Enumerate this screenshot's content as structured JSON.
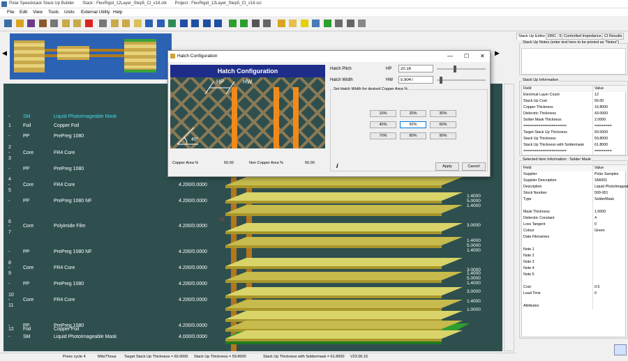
{
  "window": {
    "app_name": "Polar Speedstack Stack Up Builder",
    "stack": "Stack : FlexRigid_12Layer_Step5_CI_v18.stk",
    "project": "Project : FlexRigid_12Layer_Step5_CI_v18.sci"
  },
  "menu": [
    "File",
    "Edit",
    "View",
    "Tools",
    "Units",
    "External Utility",
    "Help"
  ],
  "toolbar_icons": [
    "new-stack-icon",
    "open-icon",
    "wizard-icon",
    "library-icon",
    "notes-icon",
    "stackup-icon",
    "rigid-flex-icon",
    "delete-icon",
    "copy-icon",
    "layer-add-icon",
    "core-add-icon",
    "prepreg-add-icon",
    "plane-add-icon",
    "signal-add-icon",
    "impedance-icon",
    "drill-icon",
    "drill-blind-icon",
    "drill-buried-icon",
    "drill-through-icon",
    "move-up-icon",
    "move-down-icon",
    "report-icon",
    "fab-icon",
    "color-icon",
    "coverlay-icon",
    "yellow-block-icon",
    "panel-icon",
    "layers-view-icon",
    "export-icon",
    "print-icon",
    "grid-icon"
  ],
  "banner": {
    "left_arrow": "◀",
    "right_arrow": "▶"
  },
  "layers": [
    {
      "num": "-",
      "type": "SM",
      "desc": "Liquid PhotoImageable Mask",
      "thick": "",
      "highlight": true
    },
    {
      "num": "1",
      "type": "Foil",
      "desc": "Copper Foil",
      "thick": ""
    },
    {
      "num": "-",
      "type": "PP",
      "desc": "PrePreg 1080",
      "thick": ""
    },
    {
      "num": "2",
      "type": "",
      "desc": "",
      "thick": ""
    },
    {
      "num": "-",
      "type": "Core",
      "desc": "FR4 Core",
      "thick": ""
    },
    {
      "num": "3",
      "type": "",
      "desc": "",
      "thick": ""
    },
    {
      "num": "-",
      "type": "PP",
      "desc": "PrePreg 1080",
      "thick": ""
    },
    {
      "num": "4",
      "type": "",
      "desc": "",
      "thick": ""
    },
    {
      "num": "-",
      "type": "Core",
      "desc": "FR4 Core",
      "thick": "4.200/0.0000"
    },
    {
      "num": "5",
      "type": "",
      "desc": "",
      "thick": ""
    },
    {
      "num": "-",
      "type": "PP",
      "desc": "PrePreg 1080 NF",
      "thick": "4.200/0.0000"
    },
    {
      "num": "6",
      "type": "",
      "desc": "",
      "thick": ""
    },
    {
      "num": "-",
      "type": "Core",
      "desc": "Polyimide Film",
      "thick": "4.200/0.0000"
    },
    {
      "num": "7",
      "type": "",
      "desc": "",
      "thick": ""
    },
    {
      "num": "-",
      "type": "PP",
      "desc": "PrePreg 1080 NF",
      "thick": "4.200/0.0000"
    },
    {
      "num": "8",
      "type": "",
      "desc": "",
      "thick": ""
    },
    {
      "num": "-",
      "type": "Core",
      "desc": "FR4 Core",
      "thick": "4.200/0.0000"
    },
    {
      "num": "9",
      "type": "",
      "desc": "",
      "thick": ""
    },
    {
      "num": "-",
      "type": "PP",
      "desc": "PrePreg 1080",
      "thick": "4.200/0.0000"
    },
    {
      "num": "10",
      "type": "",
      "desc": "",
      "thick": ""
    },
    {
      "num": "-",
      "type": "Core",
      "desc": "FR4 Core",
      "thick": "4.200/0.0000"
    },
    {
      "num": "11",
      "type": "",
      "desc": "",
      "thick": ""
    },
    {
      "num": "-",
      "type": "PP",
      "desc": "PrePreg 1080",
      "thick": "4.200/0.0000"
    },
    {
      "num": "12",
      "type": "Foil",
      "desc": "Copper Foil",
      "thick": ""
    },
    {
      "num": "-",
      "type": "SM",
      "desc": "Liquid PhotoImageable Mask",
      "thick": "4.000/0.0000"
    }
  ],
  "stack_dims": [
    "1.4000",
    "5.0000",
    "1.4000",
    "3.0000",
    "1.4000",
    "5.0000",
    "1.4000",
    "3.0000",
    "1.4000",
    "5.0000",
    "1.4000",
    "3.0000",
    "1.4000",
    "1.0000"
  ],
  "marker_label": "S1",
  "right_panel": {
    "tabs": [
      "Stack Up Editor",
      "DRC : 5",
      "Controlled Impedance",
      "CI Results"
    ],
    "notes_title": "Stack Up Notes (enter text here to be printed as \"Notes\")",
    "info_title": "Stack Up Information",
    "info_header": [
      "Field",
      "Value"
    ],
    "info_rows": [
      [
        "Electrical Layer Count",
        "12"
      ],
      [
        "Stack Up Cost",
        "66.00"
      ],
      [
        "Copper Thickness",
        "16.8000"
      ],
      [
        "Dielectric Thickness",
        "43.0000"
      ],
      [
        "Solder Mask Thickness",
        "2.0000"
      ],
      [
        "====================",
        "========"
      ],
      [
        "Target Stack Up Thickness",
        "60.0000"
      ],
      [
        "Stack Up Thickness",
        "59.8000"
      ],
      [
        "Stack Up Thickness with Soldermask",
        "61.8000"
      ],
      [
        "====================",
        "========"
      ]
    ],
    "selected_title": "Selected Item Information : Solder Mask",
    "selected_header": [
      "Field",
      "Value"
    ],
    "selected_rows": [
      [
        "Supplier",
        "Polar Samples"
      ],
      [
        "Supplier Description",
        "SM/001"
      ],
      [
        "Description",
        "Liquid PhotoImageable"
      ],
      [
        "Stock Number",
        "500-001"
      ],
      [
        "Type",
        "SolderMask"
      ],
      [
        "",
        ""
      ],
      [
        "Mask Thickness",
        "1.0000"
      ],
      [
        "Dielectric Constant",
        "4"
      ],
      [
        "Loss Tangent",
        "0"
      ],
      [
        "Colour",
        "Green"
      ],
      [
        "Data Filenames",
        ""
      ],
      [
        "",
        ""
      ],
      [
        "Note 1",
        ""
      ],
      [
        "Note 2",
        ""
      ],
      [
        "Note 3",
        ""
      ],
      [
        "Note 4",
        ""
      ],
      [
        "Note 5",
        ""
      ],
      [
        "",
        ""
      ],
      [
        "Cost",
        "0.5"
      ],
      [
        "Lead Time",
        "0"
      ],
      [
        "",
        ""
      ],
      [
        "Attributes",
        ""
      ]
    ]
  },
  "status": {
    "press_cycle": "Press cycle 4",
    "units": "Mils/Thous",
    "target": "Target Stack Up Thickness = 60.0000",
    "thickness": "Stack Up Thickness = 59.8000",
    "thickness_sm": "Stack Up Thickness with Soldermask = 61.8000",
    "version": "V23.06.15"
  },
  "dialog": {
    "title": "Hatch Configuration",
    "banner": "Hatch Configuration",
    "hp_label": "HP",
    "hw_label": "HW",
    "angle": "45°",
    "copper_area_label": "Copper Area %",
    "copper_area_value": "50.00",
    "non_copper_label": "Non Copper Area %",
    "non_copper_value": "50.00",
    "hatch_pitch_label": "Hatch Pitch",
    "hatch_pitch_code": "HP",
    "hatch_pitch_value": "20.16",
    "hatch_width_label": "Hatch Width",
    "hatch_width_code": "HW",
    "hatch_width_value": "5.9047",
    "group_title": "Set Hatch Width for desired Copper Area %",
    "percent_buttons": [
      "10%",
      "20%",
      "30%",
      "40%",
      "50%",
      "60%",
      "70%",
      "80%",
      "90%"
    ],
    "apply": "Apply",
    "cancel": "Cancel",
    "info": "i",
    "minimize": "—",
    "maximize": "☐",
    "close": "✕"
  }
}
